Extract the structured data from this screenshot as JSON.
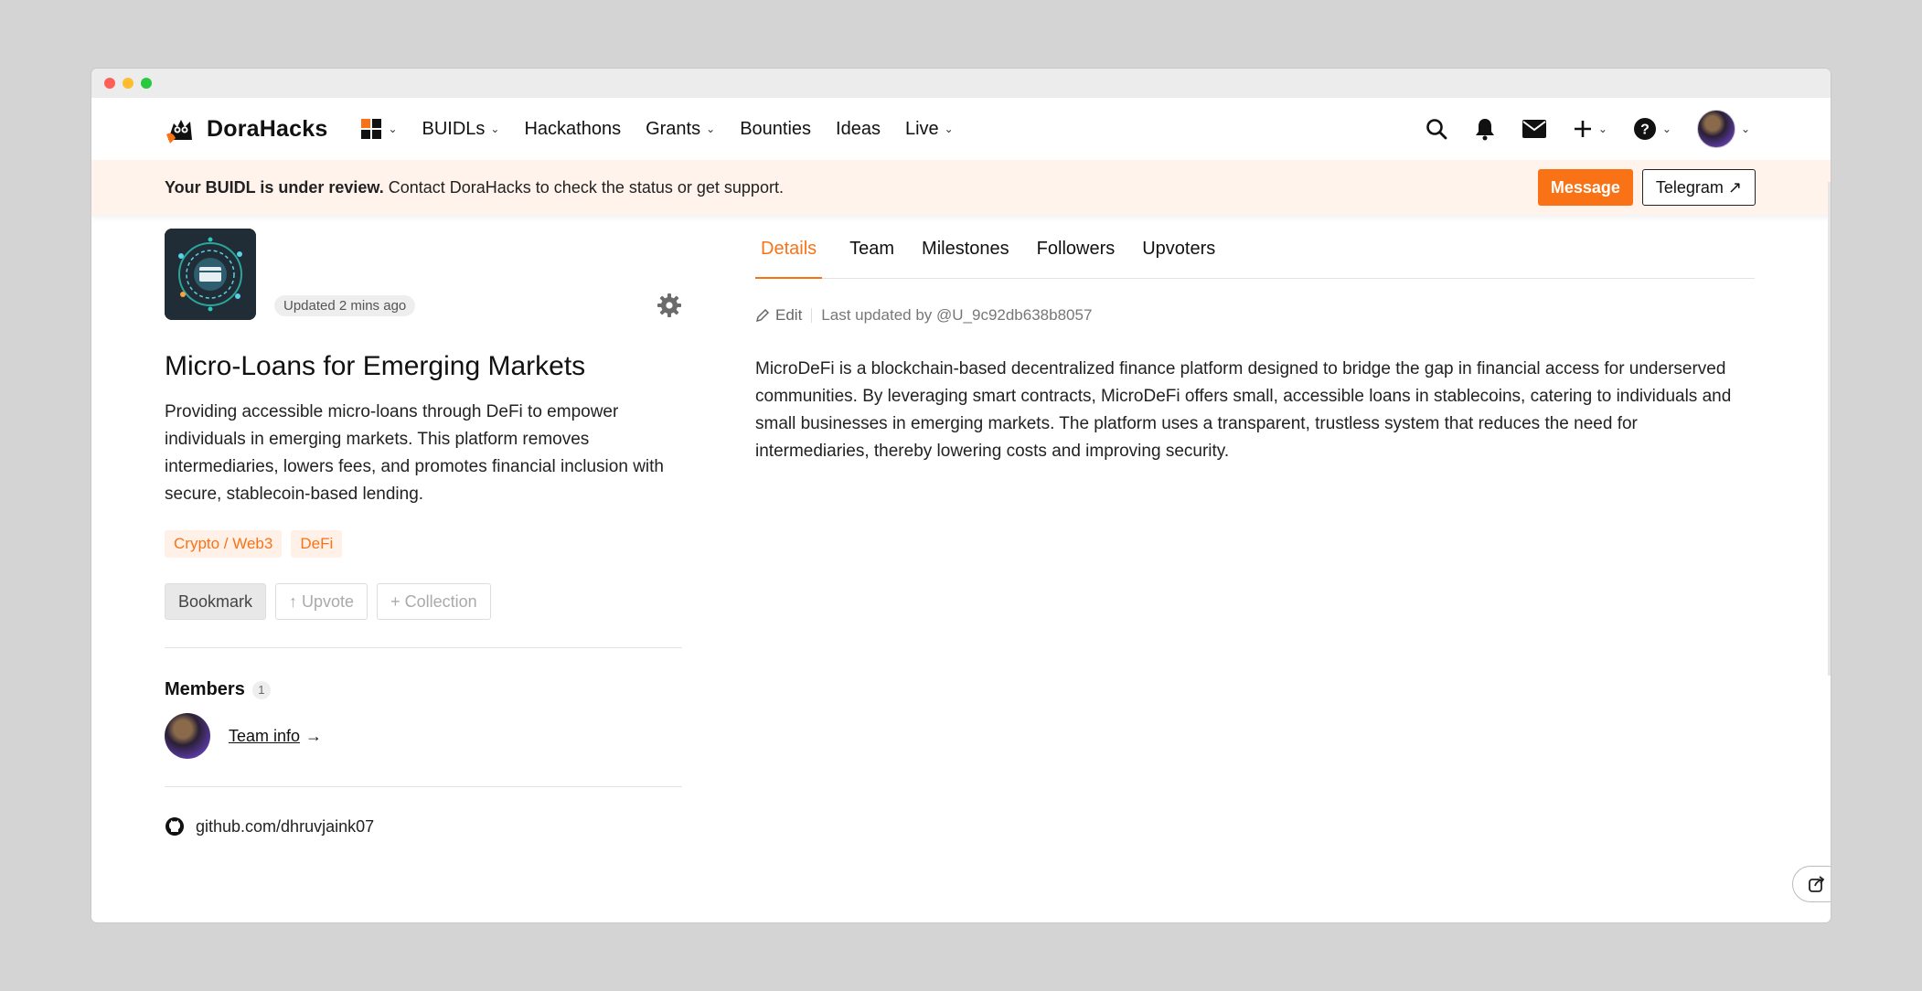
{
  "brand": {
    "name": "DoraHacks",
    "accent": "#f97316"
  },
  "nav": {
    "items": [
      {
        "label": "BUIDLs",
        "has_menu": true
      },
      {
        "label": "Hackathons",
        "has_menu": false
      },
      {
        "label": "Grants",
        "has_menu": true
      },
      {
        "label": "Bounties",
        "has_menu": false
      },
      {
        "label": "Ideas",
        "has_menu": false
      },
      {
        "label": "Live",
        "has_menu": true
      }
    ],
    "right_icons": [
      "search-icon",
      "bell-icon",
      "mail-icon",
      "plus-icon",
      "help-icon",
      "avatar"
    ]
  },
  "banner": {
    "bold": "Your BUIDL is under review.",
    "text": " Contact DoraHacks to check the status or get support.",
    "message_label": "Message",
    "telegram_label": "Telegram ↗"
  },
  "project": {
    "updated": "Updated 2 mins ago",
    "title": "Micro-Loans for Emerging Markets",
    "description": "Providing accessible micro-loans through DeFi to empower individuals in emerging markets. This platform removes intermediaries, lowers fees, and promotes financial inclusion with secure, stablecoin-based lending.",
    "tags": [
      "Crypto / Web3",
      "DeFi"
    ],
    "actions": {
      "bookmark": "Bookmark",
      "upvote": "↑ Upvote",
      "collection": "+ Collection"
    },
    "members": {
      "title": "Members",
      "count": "1",
      "team_info": "Team info",
      "arrow": "→"
    },
    "github": "github.com/dhruvjaink07"
  },
  "tabs": [
    {
      "label": "Details",
      "active": true
    },
    {
      "label": "Team",
      "active": false
    },
    {
      "label": "Milestones",
      "active": false
    },
    {
      "label": "Followers",
      "active": false
    },
    {
      "label": "Upvoters",
      "active": false
    }
  ],
  "details": {
    "edit_label": "Edit",
    "last_updated": "Last updated by @U_9c92db638b8057",
    "body": "MicroDeFi is a blockchain-based decentralized finance platform designed to bridge the gap in financial access for underserved communities. By leveraging smart contracts, MicroDeFi offers small, accessible loans in stablecoins, catering to individuals and small businesses in emerging markets. The platform uses a transparent, trustless system that reduces the need for intermediaries, thereby lowering costs and improving security."
  }
}
